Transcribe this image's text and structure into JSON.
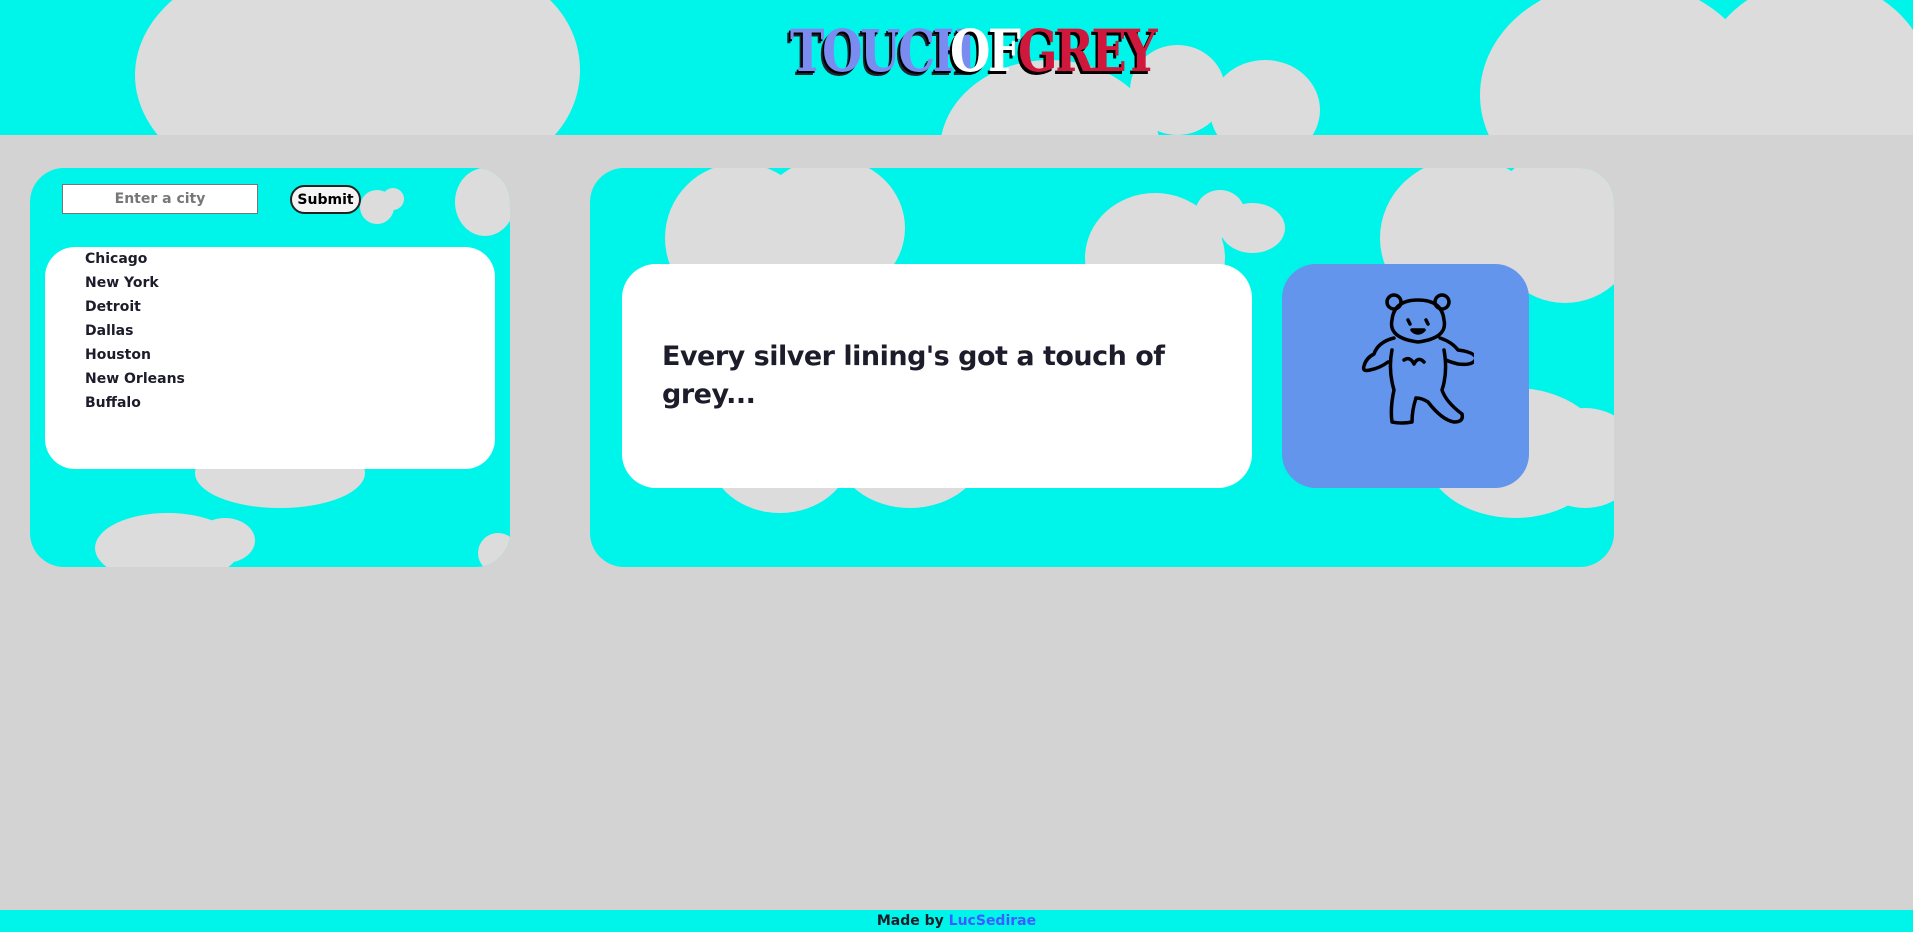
{
  "header": {
    "logo": {
      "word1": "TOUCH",
      "word2": "OF",
      "word3": "GREY"
    }
  },
  "search": {
    "input_value": "",
    "input_placeholder": "Enter a city",
    "submit_label": "Submit"
  },
  "cities": [
    "Chicago",
    "New York",
    "Detroit",
    "Dallas",
    "Houston",
    "New Orleans",
    "Buffalo"
  ],
  "main": {
    "quote": "Every silver lining's got a touch of grey..."
  },
  "footer": {
    "prefix": "Made by",
    "author": "LucSedirae"
  },
  "colors": {
    "sky": "#00f5ea",
    "cloud": "#dcdcdc",
    "background": "#d3d3d3",
    "bear_card": "#6495ed",
    "logo_red": "#d0183c",
    "logo_blue": "#7b8cf0",
    "link": "#3d5cff"
  },
  "icons": {
    "bear": "dancing-bear-icon"
  }
}
